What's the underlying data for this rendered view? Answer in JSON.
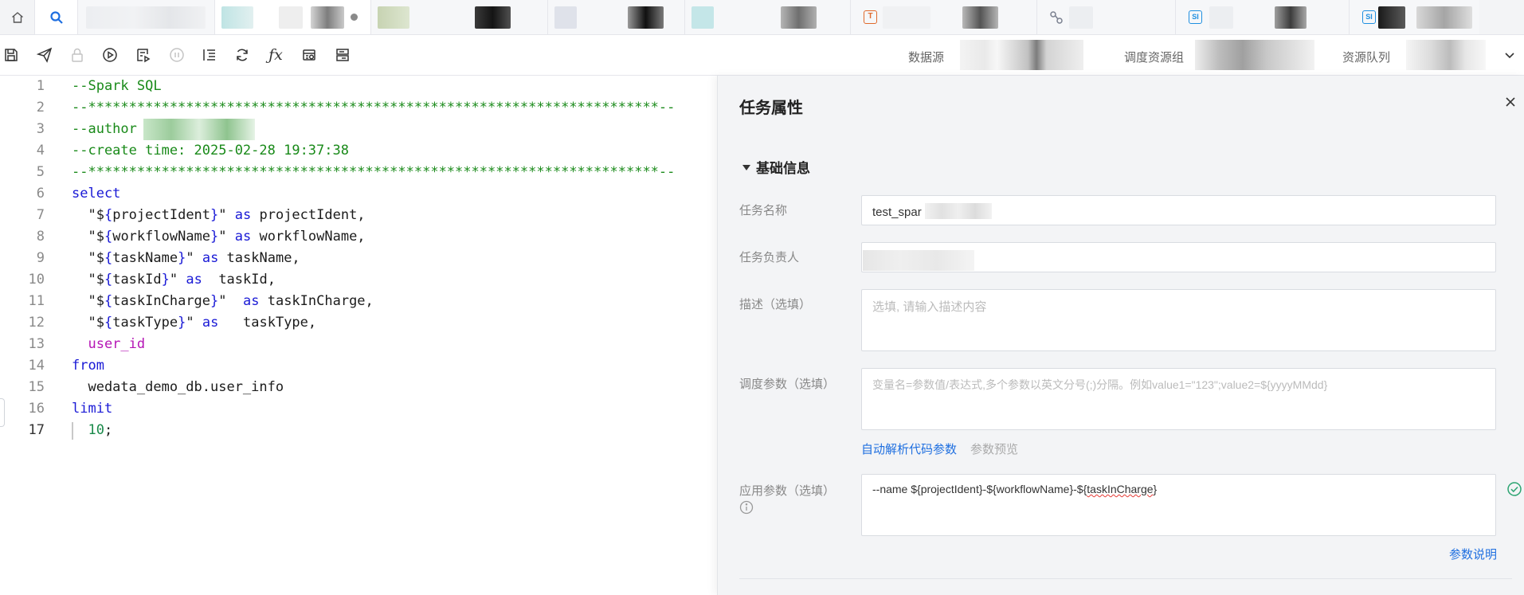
{
  "tabs": [
    {
      "id": "home"
    },
    {
      "id": "search"
    },
    {
      "id": "tab1",
      "label": ""
    },
    {
      "id": "tab2",
      "label": "",
      "active": true,
      "modified": true
    },
    {
      "id": "tab3",
      "label": ""
    },
    {
      "id": "tab4",
      "label": ""
    },
    {
      "id": "tab5",
      "label": ""
    },
    {
      "id": "tab6",
      "label": "",
      "badge": "T"
    },
    {
      "id": "tab7",
      "label": ""
    },
    {
      "id": "tab8",
      "label": "",
      "badge": "SI"
    },
    {
      "id": "tab9",
      "label": "",
      "badge": "SI"
    }
  ],
  "toolbar": {
    "icons": [
      "save-icon",
      "submit-icon",
      "lock-icon",
      "run-icon",
      "run-selected-icon",
      "pause-icon",
      "format-icon",
      "refresh-icon",
      "function-icon",
      "table-icon",
      "template-icon"
    ],
    "function_label": "ƒx",
    "datasource_label": "数据源",
    "resource_group_label": "调度资源组",
    "queue_label": "资源队列"
  },
  "editor": {
    "current_line": 17,
    "lines": [
      {
        "n": "1",
        "tokens": [
          {
            "t": "--Spark SQL",
            "c": "cm"
          }
        ]
      },
      {
        "n": "2",
        "tokens": [
          {
            "t": "--**********************************************************************--",
            "c": "cm"
          }
        ]
      },
      {
        "n": "3",
        "tokens": [
          {
            "t": "--author ",
            "c": "cm"
          }
        ]
      },
      {
        "n": "4",
        "tokens": [
          {
            "t": "--create time: 2025-02-28 19:37:38",
            "c": "cm"
          }
        ]
      },
      {
        "n": "5",
        "tokens": [
          {
            "t": "--**********************************************************************--",
            "c": "cm"
          }
        ]
      },
      {
        "n": "6",
        "tokens": [
          {
            "t": "select",
            "c": "kw"
          }
        ]
      },
      {
        "n": "7",
        "tokens": [
          {
            "t": "  \"$",
            "c": "tx"
          },
          {
            "t": "{",
            "c": "kw"
          },
          {
            "t": "projectIdent",
            "c": "tx"
          },
          {
            "t": "}",
            "c": "kw"
          },
          {
            "t": "\" ",
            "c": "tx"
          },
          {
            "t": "as",
            "c": "kw"
          },
          {
            "t": " projectIdent,",
            "c": "tx"
          }
        ]
      },
      {
        "n": "8",
        "tokens": [
          {
            "t": "  \"$",
            "c": "tx"
          },
          {
            "t": "{",
            "c": "kw"
          },
          {
            "t": "workflowName",
            "c": "tx"
          },
          {
            "t": "}",
            "c": "kw"
          },
          {
            "t": "\" ",
            "c": "tx"
          },
          {
            "t": "as",
            "c": "kw"
          },
          {
            "t": " workflowName,",
            "c": "tx"
          }
        ]
      },
      {
        "n": "9",
        "tokens": [
          {
            "t": "  \"$",
            "c": "tx"
          },
          {
            "t": "{",
            "c": "kw"
          },
          {
            "t": "taskName",
            "c": "tx"
          },
          {
            "t": "}",
            "c": "kw"
          },
          {
            "t": "\" ",
            "c": "tx"
          },
          {
            "t": "as",
            "c": "kw"
          },
          {
            "t": " taskName,",
            "c": "tx"
          }
        ]
      },
      {
        "n": "10",
        "tokens": [
          {
            "t": "  \"$",
            "c": "tx"
          },
          {
            "t": "{",
            "c": "kw"
          },
          {
            "t": "taskId",
            "c": "tx"
          },
          {
            "t": "}",
            "c": "kw"
          },
          {
            "t": "\" ",
            "c": "tx"
          },
          {
            "t": "as",
            "c": "kw"
          },
          {
            "t": "  taskId,",
            "c": "tx"
          }
        ]
      },
      {
        "n": "11",
        "tokens": [
          {
            "t": "  \"$",
            "c": "tx"
          },
          {
            "t": "{",
            "c": "kw"
          },
          {
            "t": "taskInCharge",
            "c": "tx"
          },
          {
            "t": "}",
            "c": "kw"
          },
          {
            "t": "\"  ",
            "c": "tx"
          },
          {
            "t": "as",
            "c": "kw"
          },
          {
            "t": " taskInCharge,",
            "c": "tx"
          }
        ]
      },
      {
        "n": "12",
        "tokens": [
          {
            "t": "  \"$",
            "c": "tx"
          },
          {
            "t": "{",
            "c": "kw"
          },
          {
            "t": "taskType",
            "c": "tx"
          },
          {
            "t": "}",
            "c": "kw"
          },
          {
            "t": "\" ",
            "c": "tx"
          },
          {
            "t": "as",
            "c": "kw"
          },
          {
            "t": "   taskType,",
            "c": "tx"
          }
        ]
      },
      {
        "n": "13",
        "tokens": [
          {
            "t": "  user_id",
            "c": "fn"
          }
        ]
      },
      {
        "n": "14",
        "tokens": [
          {
            "t": "from",
            "c": "kw"
          }
        ]
      },
      {
        "n": "15",
        "tokens": [
          {
            "t": "  wedata_demo_db.user_info",
            "c": "tx"
          }
        ]
      },
      {
        "n": "16",
        "tokens": [
          {
            "t": "limit",
            "c": "kw"
          }
        ]
      },
      {
        "n": "17",
        "tokens": [
          {
            "t": "  10",
            "c": "num"
          },
          {
            "t": ";",
            "c": "tx"
          }
        ]
      }
    ]
  },
  "panel": {
    "title": "任务属性",
    "section_title": "基础信息",
    "task_name_label": "任务名称",
    "task_name_value": "test_spar",
    "owner_label": "任务负责人",
    "owner_value": "",
    "description_label": "描述（选填）",
    "description_placeholder": "选填, 请输入描述内容",
    "schedule_params_label": "调度参数（选填）",
    "schedule_params_placeholder": "变量名=参数值/表达式,多个参数以英文分号(;)分隔。例如value1=\"123\";value2=${yyyyMMdd}",
    "auto_parse_link": "自动解析代码参数",
    "preview_link": "参数预览",
    "app_params_label": "应用参数（选填）",
    "app_params_value_prefix": "--name  ${projectIdent}-${workflowName}-${",
    "app_params_value_squiggle": "taskInCharge",
    "app_params_value_suffix": "}",
    "param_doc_link": "参数说明",
    "colors": {
      "accent": "#1f6fe0",
      "success": "#2ba471"
    }
  }
}
